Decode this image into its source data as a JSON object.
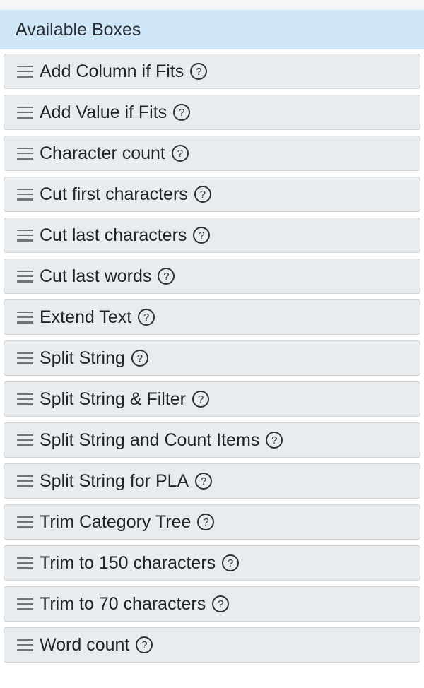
{
  "panel": {
    "title": "Available Boxes"
  },
  "icons": {
    "drag_handle": "hamburger-drag-icon",
    "help": "question-circle-icon",
    "help_glyph": "?"
  },
  "colors": {
    "header_bg": "#cfe6f7",
    "item_bg": "#e9ecef",
    "item_border": "#cfd4d8"
  },
  "boxes": [
    {
      "label": "Add Column if Fits"
    },
    {
      "label": "Add Value if Fits"
    },
    {
      "label": "Character count"
    },
    {
      "label": "Cut first characters"
    },
    {
      "label": "Cut last characters"
    },
    {
      "label": "Cut last words"
    },
    {
      "label": "Extend Text"
    },
    {
      "label": "Split String"
    },
    {
      "label": "Split String & Filter"
    },
    {
      "label": "Split String and Count Items"
    },
    {
      "label": "Split String for PLA"
    },
    {
      "label": "Trim Category Tree"
    },
    {
      "label": "Trim to 150 characters"
    },
    {
      "label": "Trim to 70 characters"
    },
    {
      "label": "Word count"
    }
  ]
}
